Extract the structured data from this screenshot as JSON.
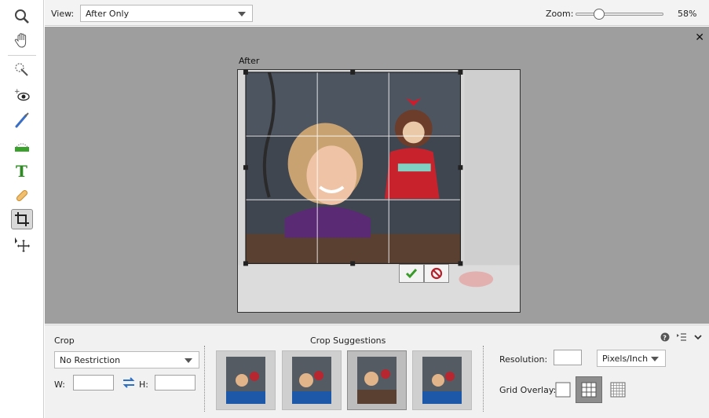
{
  "topbar": {
    "view_label": "View:",
    "view_value": "After Only",
    "zoom_label": "Zoom:",
    "zoom_value": "58%",
    "zoom_level": 0.58
  },
  "canvas": {
    "after_label": "After",
    "close_icon": "close-icon",
    "background_color": "#9e9e9e"
  },
  "toolbar": {
    "tools": [
      "zoom-tool",
      "hand-tool",
      "quick-selection-tool",
      "red-eye-tool",
      "whiten-teeth-tool",
      "straighten-tool",
      "type-tool",
      "spot-healing-tool",
      "crop-tool",
      "move-tool"
    ],
    "active_tool": "crop-tool"
  },
  "panel": {
    "crop_title": "Crop",
    "crop_option": "No Restriction",
    "w_label": "W:",
    "h_label": "H:",
    "w_value": "",
    "h_value": "",
    "suggestions_title": "Crop Suggestions",
    "resolution_label": "Resolution:",
    "resolution_value": "",
    "resolution_unit": "Pixels/Inch",
    "grid_overlay_label": "Grid Overlay:",
    "grid_options": [
      "none",
      "rule-of-thirds",
      "grid"
    ],
    "grid_selected": "rule-of-thirds",
    "selected_suggestion": 2
  },
  "colors": {
    "accent_check": "#3a9a2a",
    "cancel_red": "#b41f2a"
  }
}
